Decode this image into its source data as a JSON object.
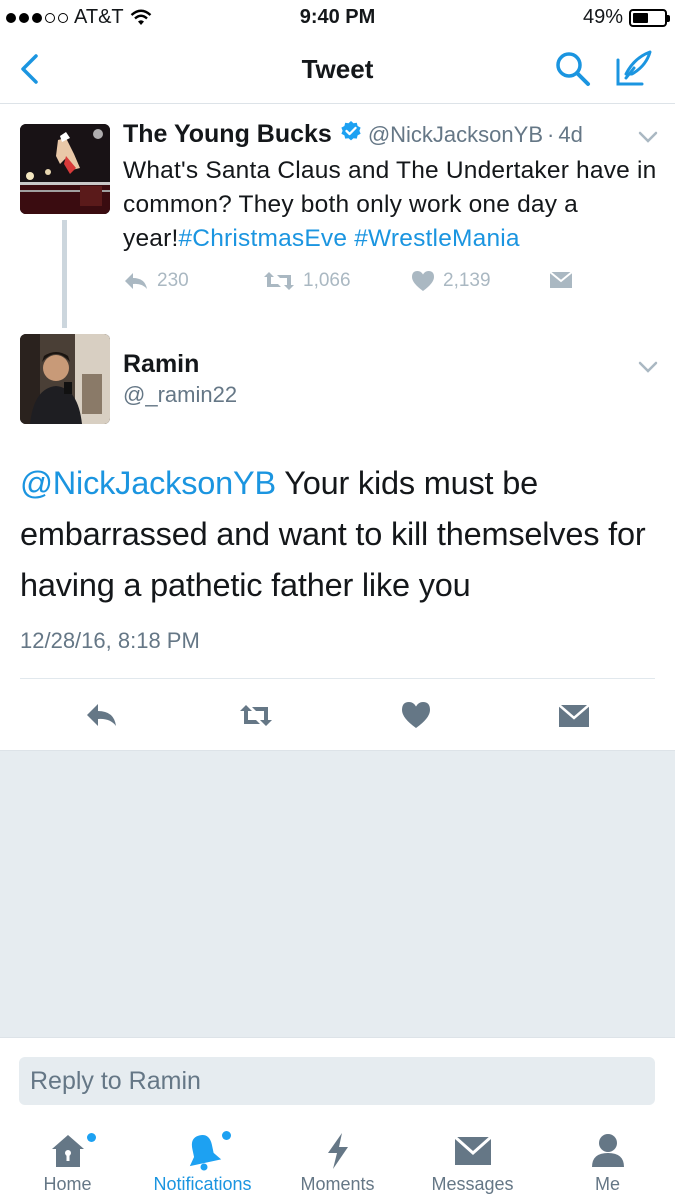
{
  "status_bar": {
    "carrier": "AT&T",
    "time": "9:40 PM",
    "battery": "49%",
    "battery_level": 0.49
  },
  "nav": {
    "title": "Tweet",
    "back_icon": "chevron-left-icon",
    "search_icon": "search-icon",
    "compose_icon": "compose-icon"
  },
  "original_tweet": {
    "name": "The Young Bucks",
    "verified": true,
    "handle": "@NickJacksonYB",
    "separator": "·",
    "time": "4d",
    "text_plain": "What's Santa Claus and The Undertaker have in common? They both only work one day a year!",
    "hashtags": [
      "#ChristmasEve",
      "#WrestleMania"
    ],
    "replies": "230",
    "retweets": "1,066",
    "likes": "2,139"
  },
  "reply_tweet": {
    "name": "Ramin",
    "handle": "@_ramin22",
    "mention": "@NickJacksonYB",
    "text": " Your kids must be embarrassed and want to kill themselves for having a pathetic father like you",
    "date": "12/28/16, 8:18 PM"
  },
  "composer": {
    "placeholder": "Reply to Ramin"
  },
  "tabs": [
    {
      "label": "Home",
      "icon": "home-icon",
      "active": false,
      "badge": true
    },
    {
      "label": "Notifications",
      "icon": "bell-icon",
      "active": true,
      "badge": true
    },
    {
      "label": "Moments",
      "icon": "lightning-icon",
      "active": false,
      "badge": false
    },
    {
      "label": "Messages",
      "icon": "envelope-icon",
      "active": false,
      "badge": false
    },
    {
      "label": "Me",
      "icon": "person-icon",
      "active": false,
      "badge": false
    }
  ],
  "colors": {
    "accent": "#1b95e0",
    "text": "#14171a",
    "secondary": "#657786",
    "action_gray": "#aab8c2",
    "divider": "#e1e8ed",
    "background_gray": "#e6ecf0"
  }
}
